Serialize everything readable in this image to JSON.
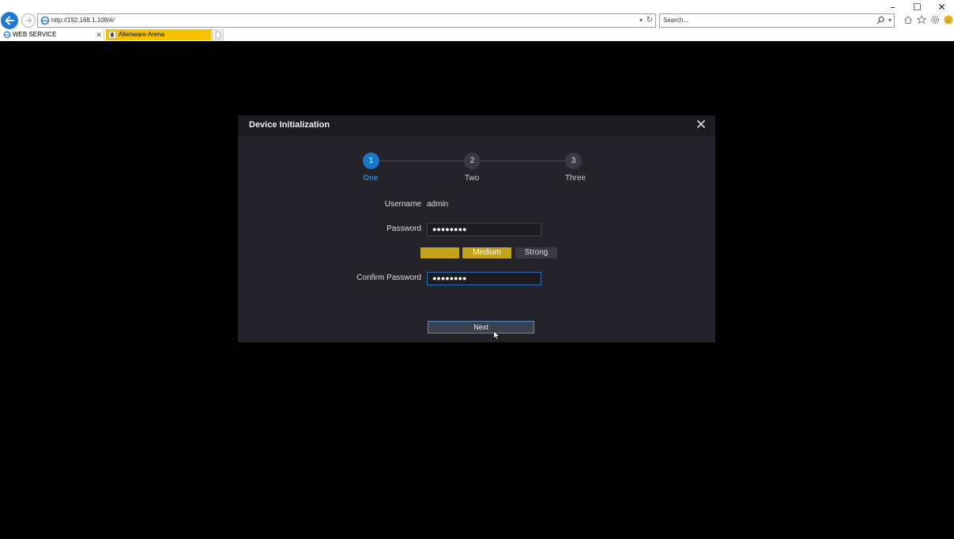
{
  "browser": {
    "url": "http://192.168.1.108/#/",
    "search_placeholder": "Search...",
    "tabs": [
      {
        "label": "WEB SERVICE",
        "active": true
      },
      {
        "label": "Alienware Arena",
        "active": false
      }
    ],
    "window_controls": {
      "minimize": "–",
      "maximize": "☐",
      "close": "✕"
    }
  },
  "dialog": {
    "title": "Device Initialization",
    "steps": [
      {
        "number": "1",
        "label": "One",
        "active": true
      },
      {
        "number": "2",
        "label": "Two",
        "active": false
      },
      {
        "number": "3",
        "label": "Three",
        "active": false
      }
    ],
    "username_label": "Username",
    "username_value": "admin",
    "password_label": "Password",
    "password_value": "●●●●●●●●",
    "confirm_label": "Confirm Password",
    "confirm_value": "●●●●●●●●",
    "strength": {
      "weak": "",
      "medium": "Medium",
      "strong": "Strong"
    },
    "next_label": "Next"
  },
  "colors": {
    "accent": "#1978c8",
    "strength_active": "#c2a31b",
    "alienware_tab": "#f5c300"
  }
}
